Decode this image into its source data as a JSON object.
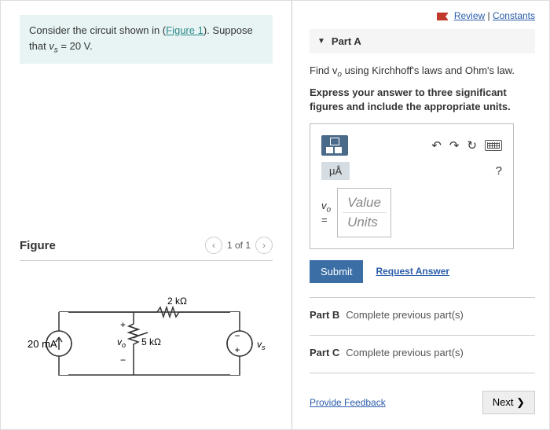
{
  "top": {
    "review": "Review",
    "constants": "Constants"
  },
  "prompt": {
    "pre": "Consider the circuit shown in (",
    "link": "Figure 1",
    "post": "). Suppose that ",
    "given": "v",
    "given_sub": "s",
    "given_rest": " = 20 V."
  },
  "figure": {
    "title": "Figure",
    "counter": "1 of 1"
  },
  "circuit": {
    "src": "20 mA",
    "r1": "5 kΩ",
    "r2": "2 kΩ",
    "vo": "v",
    "vo_sub": "o",
    "vs": "v",
    "vs_sub": "s",
    "plus": "+",
    "minus": "−"
  },
  "partA": {
    "label": "Part A",
    "q": "Find v",
    "q_sub": "o",
    "q_rest": " using Kirchhoff's laws and Ohm's law.",
    "instruct": "Express your answer to three significant figures and include the appropriate units."
  },
  "toolbar": {
    "units_chip": "μÅ",
    "help": "?"
  },
  "answer": {
    "var": "v",
    "var_sub": "o",
    "eq": "=",
    "value_ph": "Value",
    "units_ph": "Units"
  },
  "actions": {
    "submit": "Submit",
    "request": "Request Answer"
  },
  "partB": {
    "label": "Part B",
    "msg": "Complete previous part(s)"
  },
  "partC": {
    "label": "Part C",
    "msg": "Complete previous part(s)"
  },
  "bottom": {
    "feedback": "Provide Feedback",
    "next": "Next ❯"
  }
}
